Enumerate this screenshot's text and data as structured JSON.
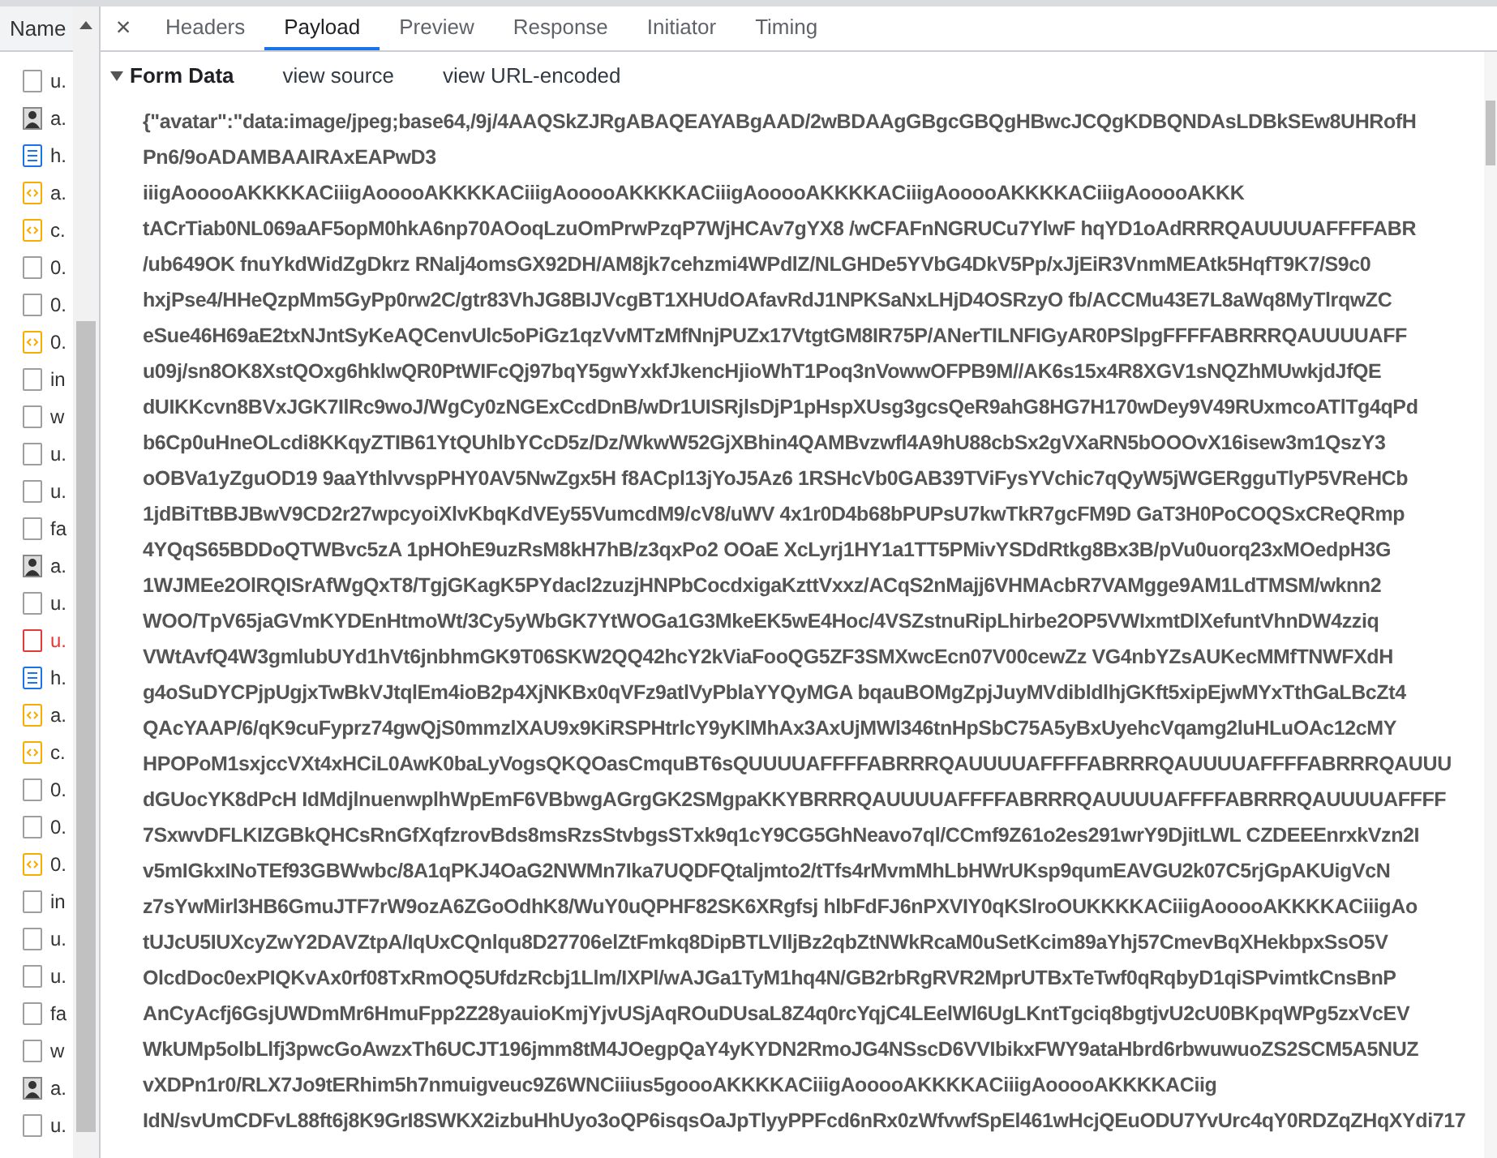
{
  "requests": {
    "header": "Name",
    "items": [
      {
        "name": "u.",
        "kind": "blank",
        "failed": false
      },
      {
        "name": "a.",
        "kind": "image",
        "failed": false
      },
      {
        "name": "h.",
        "kind": "document",
        "failed": false
      },
      {
        "name": "a.",
        "kind": "script",
        "failed": false
      },
      {
        "name": "c.",
        "kind": "script",
        "failed": false
      },
      {
        "name": "0.",
        "kind": "blank",
        "failed": false
      },
      {
        "name": "0.",
        "kind": "blank",
        "failed": false
      },
      {
        "name": "0.",
        "kind": "script",
        "failed": false
      },
      {
        "name": "in",
        "kind": "blank",
        "failed": false
      },
      {
        "name": "w",
        "kind": "blank",
        "failed": false
      },
      {
        "name": "u.",
        "kind": "blank",
        "failed": false
      },
      {
        "name": "u.",
        "kind": "blank",
        "failed": false
      },
      {
        "name": "fa",
        "kind": "blank",
        "failed": false
      },
      {
        "name": "a.",
        "kind": "image",
        "failed": false
      },
      {
        "name": "u.",
        "kind": "blank",
        "failed": false
      },
      {
        "name": "u.",
        "kind": "blank",
        "failed": true
      },
      {
        "name": "h.",
        "kind": "document",
        "failed": false
      },
      {
        "name": "a.",
        "kind": "script",
        "failed": false
      },
      {
        "name": "c.",
        "kind": "script",
        "failed": false
      },
      {
        "name": "0.",
        "kind": "blank",
        "failed": false
      },
      {
        "name": "0.",
        "kind": "blank",
        "failed": false
      },
      {
        "name": "0.",
        "kind": "script",
        "failed": false
      },
      {
        "name": "in",
        "kind": "blank",
        "failed": false
      },
      {
        "name": "u.",
        "kind": "blank",
        "failed": false
      },
      {
        "name": "u.",
        "kind": "blank",
        "failed": false
      },
      {
        "name": "fa",
        "kind": "blank",
        "failed": false
      },
      {
        "name": "w",
        "kind": "blank",
        "failed": false
      },
      {
        "name": "a.",
        "kind": "image",
        "failed": false
      },
      {
        "name": "u.",
        "kind": "blank",
        "failed": false
      }
    ]
  },
  "close_label": "×",
  "tabs": [
    {
      "label": "Headers",
      "selected": false
    },
    {
      "label": "Payload",
      "selected": true
    },
    {
      "label": "Preview",
      "selected": false
    },
    {
      "label": "Response",
      "selected": false
    },
    {
      "label": "Initiator",
      "selected": false
    },
    {
      "label": "Timing",
      "selected": false
    }
  ],
  "form_data": {
    "title": "Form Data",
    "expanded": true,
    "links": [
      "view source",
      "view URL-encoded"
    ],
    "lines": [
      "{\"avatar\":\"data:image/jpeg;base64,/9j/4AAQSkZJRgABAQEAYABgAAD/2wBDAAgGBgcGBQgHBwcJCQgKDBQNDAsLDBkSEw8UHRofH",
      "Pn6/9oADAMBAAIRAxEAPwD3",
      "iiigAooooAKKKKACiiigAooooAKKKKACiiigAooooAKKKKACiiigAooooAKKKKACiiigAooooAKKKKACiiigAooooAKKK",
      "tACrTiab0NL069aAF5opM0hkA6np70AOoqLzuOmPrwPzqP7WjHCAv7gYX8 /wCFAFnNGRUCu7YlwF hqYD1oAdRRRQAUUUUAFFFFABR",
      "/ub649OK fnuYkdWidZgDkrz RNalj4omsGX92DH/AM8jk7cehzmi4WPdlZ/NLGHDe5YVbG4DkV5Pp/xJjEiR3VnmMEAtk5HqfT9K7/S9c0",
      "hxjPse4/HHeQzpMm5GyPp0rw2C/gtr83VhJG8BIJVcgBT1XHUdOAfavRdJ1NPKSaNxLHjD4OSRzyO fb/ACCMu43E7L8aWq8MyTlrqwZC",
      "eSue46H69aE2txNJntSyKeAQCenvUlc5oPiGz1qzVvMTzMfNnjPUZx17VtgtGM8IR75P/ANerTILNFIGyAR0PSlpgFFFFABRRRQAUUUUAFF",
      "u09j/sn8OK8XstQOxg6hklwQR0PtWIFcQj97bqY5gwYxkfJkencHjioWhT1Poq3nVowwOFPB9M//AK6s15x4R8XGV1sNQZhMUwkjdJfQE",
      "dUIKKcvn8BVxJGK7IlRc9woJ/WgCy0zNGExCcdDnB/wDr1UISRjlsDjP1pHspXUsg3gcsQeR9ahG8HG7H170wDey9V49RUxmcoATlTg4qPd",
      "b6Cp0uHneOLcdi8KKqyZTIB61YtQUhlbYCcD5z/Dz/WkwW52GjXBhin4QAMBvzwfl4A9hU88cbSx2gVXaRN5bOOOvX16isew3m1QszY3",
      "oOBVa1yZguOD19 9aaYthlvvspPHY0AV5NwZgx5H f8ACpl13jYoJ5Az6 1RSHcVb0GAB39TViFysYVchic7qQyW5jWGERgguTlyP5VReHCb",
      "1jdBiTtBBJBwV9CD2r27wpcyoiXlvKbqKdVEy55VumcdM9/cV8/uWV 4x1r0D4b68bPUPsU7kwTkR7gcFM9D GaT3H0PoCOQSxCReQRmp",
      "4YQqS65BDDoQTWBvc5zA 1pHOhE9uzRsM8kH7hB/z3qxPo2 OOaE XcLyrj1HY1a1TT5PMivYSDdRtkg8Bx3B/pVu0uorq23xMOedpH3G",
      "1WJMEe2OlRQISrAfWgQxT8/TgjGKagK5PYdacl2zuzjHNPbCocdxigaKzttVxxz/ACqS2nMajj6VHMAcbR7VAMgge9AM1LdTMSM/wknn2",
      "WOO/TpV65jaGVmKYDEnHtmoWt/3Cy5yWbGK7YtWOGa1G3MkeEK5wE4Hoc/4VSZstnuRipLhirbe2OP5VWIxmtDlXefuntVhnDW4zziq",
      "VWtAvfQ4W3gmlubUYd1hVt6jnbhmGK9T06SKW2QQ42hcY2kViaFooQG5ZF3SMXwcEcn07V00cewZz VG4nbYZsAUKecMMfTNWFXdH",
      "g4oSuDYCPjpUgjxTwBkVJtqlEm4ioB2p4XjNKBx0qVFz9atlVyPblaYYQyMGA bqauBOMgZpjJuyMVdibldlhjGKft5xipEjwMYxTthGaLBcZt4",
      "QAcYAAP/6/qK9cuFyprz74gwQjS0mmzlXAU9x9KiRSPHtrlcY9yKlMhAx3AxUjMWl346tnHpSbC75A5yBxUyehcVqamg2luHLuOAc12cMY",
      "HPOPoM1sxjccVXt4xHCiL0AwK0baLyVogsQKQOasCmquBT6sQUUUUAFFFFABRRRQAUUUUAFFFFABRRRQAUUUUAFFFFABRRRQAUUU",
      "dGUocYK8dPcH IdMdjlnuenwplhWpEmF6VBbwgAGrgGK2SMgpaKKYBRRRQAUUUUAFFFFABRRRQAUUUUAFFFFABRRRQAUUUUAFFFF",
      "7SxwvDFLKIZGBkQHCsRnGfXqfzrovBds8msRzsStvbgsSTxk9q1cY9CG5GhNeavo7ql/CCmf9Z61o2es291wrY9DjitLWL CZDEEEnrxkVzn2I",
      "v5mIGkxINoTEf93GBWwbc/8A1qPKJ4OaG2NWMn7Ika7UQDFQtaljmto2/tTfs4rMvmMhLbHWrUKsp9qumEAVGU2k07C5rjGpAKUigVcN",
      "z7sYwMirl3HB6GmuJTF7rW9ozA6ZGoOdhK8/WuY0uQPHF82SK6XRgfsj hlbFdFJ6nPXVIY0qKSlroOUKKKKACiiigAooooAKKKKACiiigAo",
      "tUJcU5IUXcyZwY2DAVZtpA/IqUxCQnlqu8D27706elZtFmkq8DipBTLVIljBz2qbZtNWkRcaM0uSetKcim89aYhj57CmevBqXHekbpxSsO5V",
      "OlcdDoc0exPIQKvAx0rf08TxRmOQ5UfdzRcbj1Llm/IXPl/wAJGa1TyM1hq4N/GB2rbRgRVR2MprUTBxTeTwf0qRqbyD1qiSPvimtkCnsBnP",
      "AnCyAcfj6GsjUWDmMr6HmuFpp2Z28yauioKmjYjvUSjAqROuDUsaL8Z4q0rcYqjC4LEelWl6UgLKntTgciq8bgtjvU2cU0BKpqWPg5zxVcEV",
      "WkUMp5olbLlfj3pwcGoAwzxTh6UCJT196jmm8tM4JOegpQaY4yKYDN2RmoJG4NSscD6VVIbikxFWY9ataHbrd6rbwuwuoZS2SCM5A5NUZ",
      "vXDPn1r0/RLX7Jo9tERhim5h7nmuigveuc9Z6WNCiiius5goooAKKKKACiiigAooooAKKKKACiiigAooooAKKKKACiig",
      "IdN/svUmCDFvL88ft6j8K9GrI8SWKX2izbuHhUyo3oQP6isqsOaJpTlyyPPFcd6nRx0zWfvwfSpEl461wHcjQEuODU7YvUrc4qY0RDZqZHqXYdi717"
    ]
  }
}
